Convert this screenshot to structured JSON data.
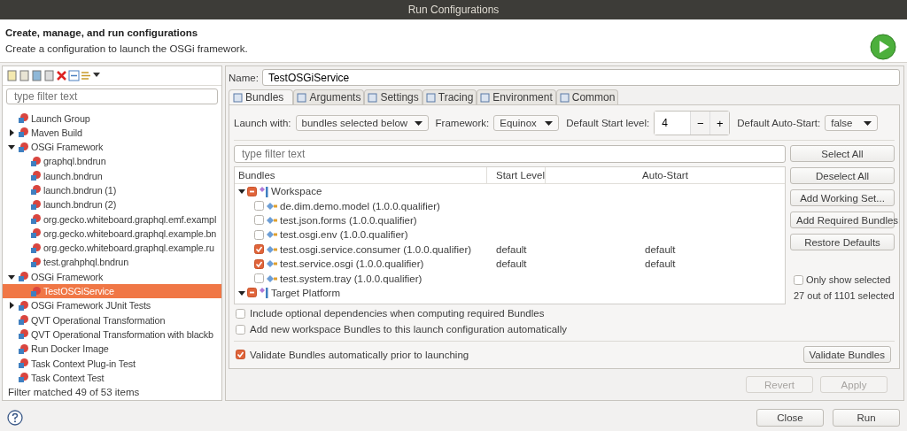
{
  "window": {
    "title": "Run Configurations"
  },
  "header": {
    "title": "Create, manage, and run configurations",
    "subtitle": "Create a configuration to launch the OSGi framework."
  },
  "sidebar": {
    "filter": {
      "placeholder": "type filter text"
    },
    "tree": [
      {
        "label": "Launch Group",
        "selected": false
      },
      {
        "label": "Maven Build",
        "selected": false,
        "expanded": false
      },
      {
        "label": "OSGi Framework",
        "selected": false,
        "expanded": true,
        "children": [
          {
            "label": "graphql.bndrun",
            "selected": false
          },
          {
            "label": "launch.bndrun",
            "selected": false
          },
          {
            "label": "launch.bndrun (1)",
            "selected": false
          },
          {
            "label": "launch.bndrun (2)",
            "selected": false
          },
          {
            "label": "org.gecko.whiteboard.graphql.emf.exampl",
            "selected": false
          },
          {
            "label": "org.gecko.whiteboard.graphql.example.bn",
            "selected": false
          },
          {
            "label": "org.gecko.whiteboard.graphql.example.ru",
            "selected": false
          },
          {
            "label": "test.grahphql.bndrun",
            "selected": false
          }
        ]
      },
      {
        "label": "OSGi Framework",
        "selected": false,
        "expanded": true,
        "children": [
          {
            "label": "TestOSGiService",
            "selected": true
          }
        ]
      },
      {
        "label": "OSGi Framework JUnit Tests",
        "selected": false,
        "expanded": false
      },
      {
        "label": "QVT Operational Transformation",
        "selected": false
      },
      {
        "label": "QVT Operational Transformation with blackb",
        "selected": false
      },
      {
        "label": "Run Docker Image",
        "selected": false
      },
      {
        "label": "Task Context Plug-in Test",
        "selected": false
      },
      {
        "label": "Task Context Test",
        "selected": false
      }
    ],
    "status": "Filter matched 49 of 53 items"
  },
  "name_field": {
    "label": "Name:",
    "value": "TestOSGiService"
  },
  "tabs": [
    {
      "label": "Bundles",
      "selected": true
    },
    {
      "label": "Arguments",
      "selected": false
    },
    {
      "label": "Settings",
      "selected": false
    },
    {
      "label": "Tracing",
      "selected": false
    },
    {
      "label": "Environment",
      "selected": false
    },
    {
      "label": "Common",
      "selected": false
    }
  ],
  "launch": {
    "launch_with_label": "Launch with:",
    "launch_with": "bundles selected below",
    "framework_label": "Framework:",
    "framework": "Equinox",
    "start_level_label": "Default Start level:",
    "start_level": "4",
    "decrement": "−",
    "increment": "+",
    "auto_start_label": "Default Auto-Start:",
    "auto_start": "false"
  },
  "bundle_filter": {
    "placeholder": "type filter text"
  },
  "table": {
    "columns": [
      "Bundles",
      "Start Level",
      "Auto-Start"
    ],
    "rows": [
      {
        "kind": "group",
        "name": "Workspace",
        "checked": true,
        "mixed": true,
        "expanded": true
      },
      {
        "kind": "bundle",
        "name": "de.dim.demo.model (1.0.0.qualifier)",
        "checked": false
      },
      {
        "kind": "bundle",
        "name": "test.json.forms (1.0.0.qualifier)",
        "checked": false
      },
      {
        "kind": "bundle",
        "name": "test.osgi.env (1.0.0.qualifier)",
        "checked": false
      },
      {
        "kind": "bundle",
        "name": "test.osgi.service.consumer (1.0.0.qualifier)",
        "checked": true,
        "start_level": "default",
        "auto_start": "default"
      },
      {
        "kind": "bundle",
        "name": "test.service.osgi (1.0.0.qualifier)",
        "checked": true,
        "start_level": "default",
        "auto_start": "default"
      },
      {
        "kind": "bundle",
        "name": "test.system.tray (1.0.0.qualifier)",
        "checked": false
      },
      {
        "kind": "group",
        "name": "Target Platform",
        "checked": true,
        "mixed": true,
        "expanded": true
      }
    ]
  },
  "side_buttons": [
    "Select All",
    "Deselect All",
    "Add Working Set...",
    "Add Required Bundles",
    "Restore Defaults"
  ],
  "only_selected": {
    "label": "Only show selected",
    "checked": false
  },
  "selection_count": "27 out of 1101 selected",
  "options": [
    {
      "label": "Include optional dependencies when computing required Bundles",
      "checked": false
    },
    {
      "label": "Add new workspace Bundles to this launch configuration automatically",
      "checked": false
    }
  ],
  "validate": {
    "label": "Validate Bundles automatically prior to launching",
    "checked": true,
    "button": "Validate Bundles"
  },
  "form_buttons": [
    {
      "label": "Revert",
      "disabled": true
    },
    {
      "label": "Apply",
      "disabled": true
    }
  ],
  "dialog_buttons": [
    "Close",
    "Run"
  ]
}
